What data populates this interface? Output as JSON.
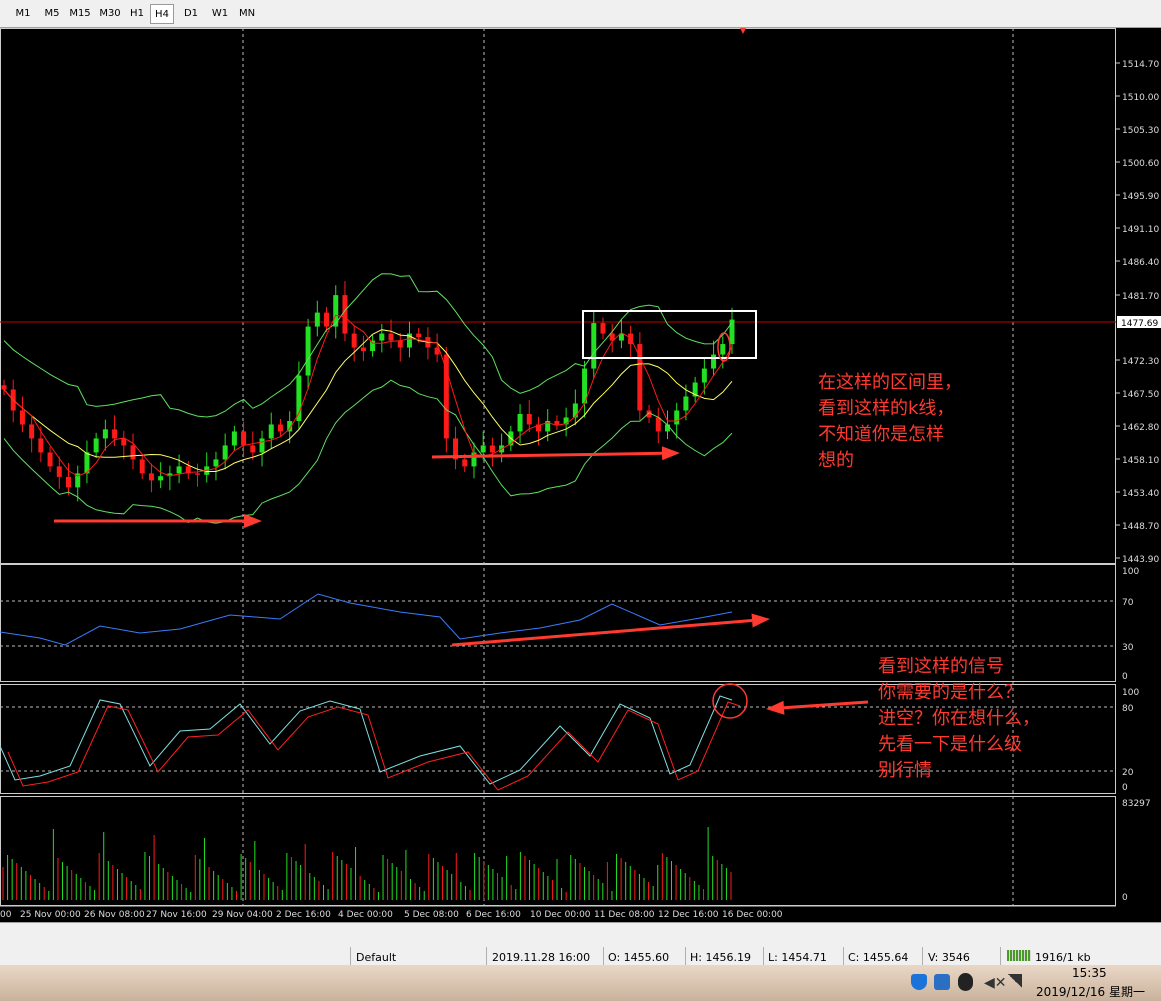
{
  "timeframes": [
    "M1",
    "M5",
    "M15",
    "M30",
    "H1",
    "H4",
    "D1",
    "W1",
    "MN"
  ],
  "active_timeframe": "H4",
  "price_axis": [
    "1514.70",
    "1510.00",
    "1505.30",
    "1500.60",
    "1495.90",
    "1491.10",
    "1486.40",
    "1481.70",
    "1472.30",
    "1467.50",
    "1462.80",
    "1458.10",
    "1453.40",
    "1448.70",
    "1443.90"
  ],
  "current_price": "1477.69",
  "rsi_axis": [
    "100",
    "70",
    "30",
    "0"
  ],
  "stoch_axis": [
    "100",
    "80",
    "20",
    "0"
  ],
  "volume_axis": [
    "83297",
    "0"
  ],
  "time_axis": [
    "00",
    "25 Nov 00:00",
    "26 Nov 08:00",
    "27 Nov 16:00",
    "29 Nov 04:00",
    "2 Dec 16:00",
    "4 Dec 00:00",
    "5 Dec 08:00",
    "6 Dec 16:00",
    "10 Dec 00:00",
    "11 Dec 08:00",
    "12 Dec 16:00",
    "16 Dec 00:00"
  ],
  "annotations": {
    "box_note": "在这样的区间里，\n看到这样的k线，\n不知道你是怎样\n想的",
    "signal_note": "看到这样的信号\n你需要的是什么？\n进空？你在想什么，\n先看一下是什么级\n别行情"
  },
  "status": {
    "profile": "Default",
    "time": "2019.11.28 16:00",
    "open": "O: 1455.60",
    "high": "H: 1456.19",
    "low": "L: 1454.71",
    "close": "C: 1455.64",
    "volume": "V: 3546",
    "traffic": "1916/1 kb"
  },
  "clock": {
    "time": "15:35",
    "date": "2019/12/16 星期一"
  },
  "colors": {
    "bull": "#22e122",
    "bear": "#ff1a1a",
    "band": "#5fe05f",
    "ma": "#ffff66",
    "rsi": "#3a7dff",
    "stoch_main": "#7fe0e0",
    "stoch_signal": "#ff2020",
    "annot": "#ff3a30"
  },
  "icons": [
    "shield-icon",
    "network-icon",
    "qq-icon",
    "volume-icon",
    "signal-icon"
  ]
}
